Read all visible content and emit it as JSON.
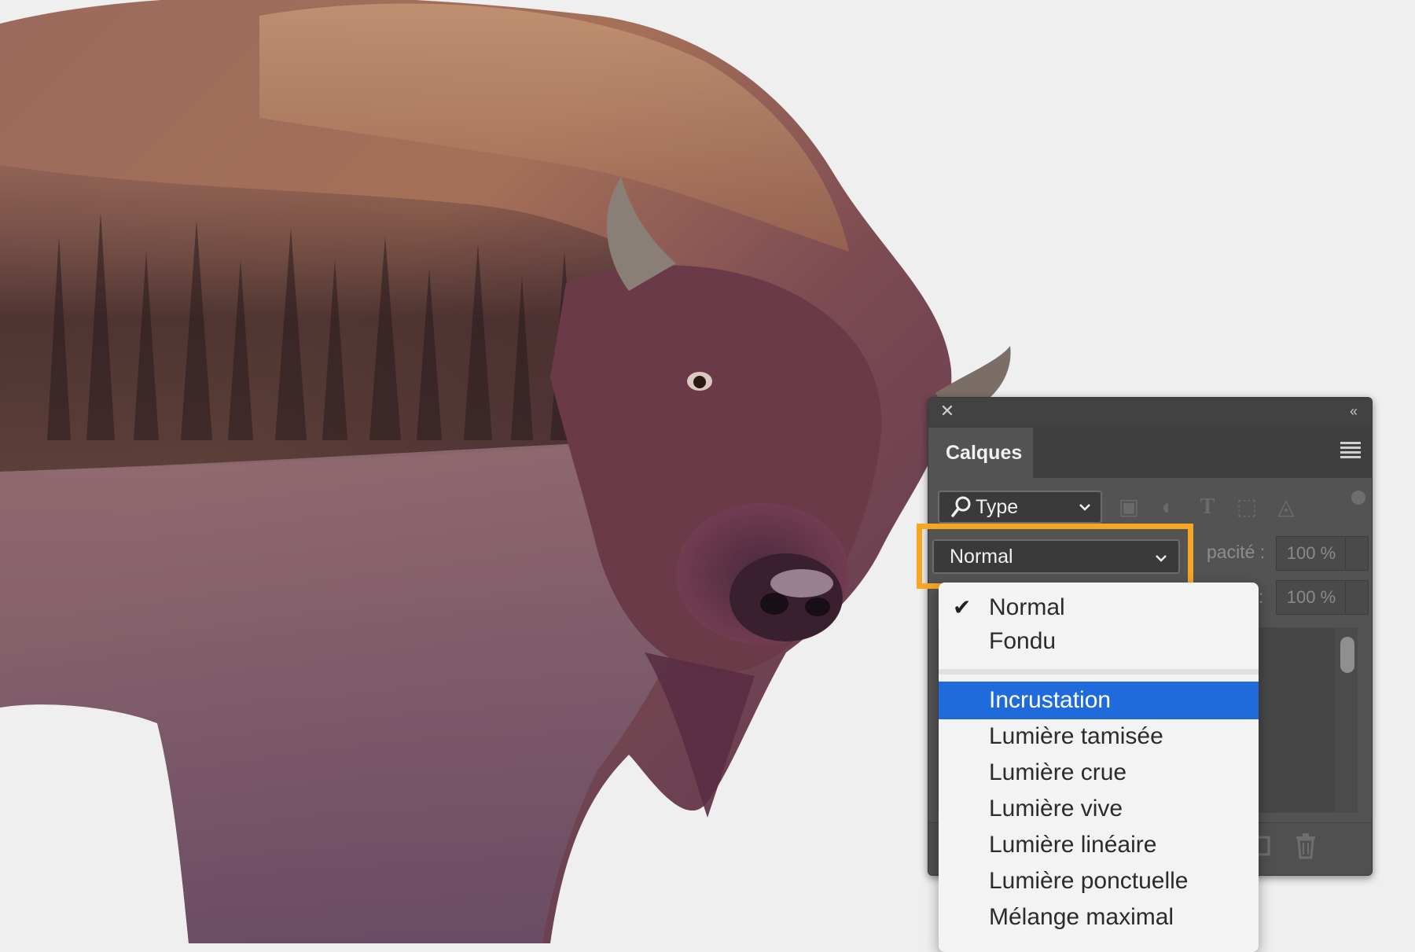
{
  "panel": {
    "title": "Calques",
    "filter_label": "Type",
    "blend_mode": "Normal",
    "opacity_label": "pacité :",
    "opacity_value": "100 %",
    "fill_label": ":",
    "fill_value": "100 %"
  },
  "menu": {
    "items": [
      {
        "label": "Normal",
        "checked": true
      },
      {
        "label": "Fondu"
      },
      {
        "label": "Incrustation",
        "selected": true
      },
      {
        "label": "Lumière tamisée"
      },
      {
        "label": "Lumière crue"
      },
      {
        "label": "Lumière vive"
      },
      {
        "label": "Lumière linéaire"
      },
      {
        "label": "Lumière ponctuelle"
      },
      {
        "label": "Mélange maximal"
      }
    ]
  },
  "colors": {
    "highlight": "#f6a623",
    "selection": "#1f6bdc",
    "panel_bg": "#535353"
  }
}
